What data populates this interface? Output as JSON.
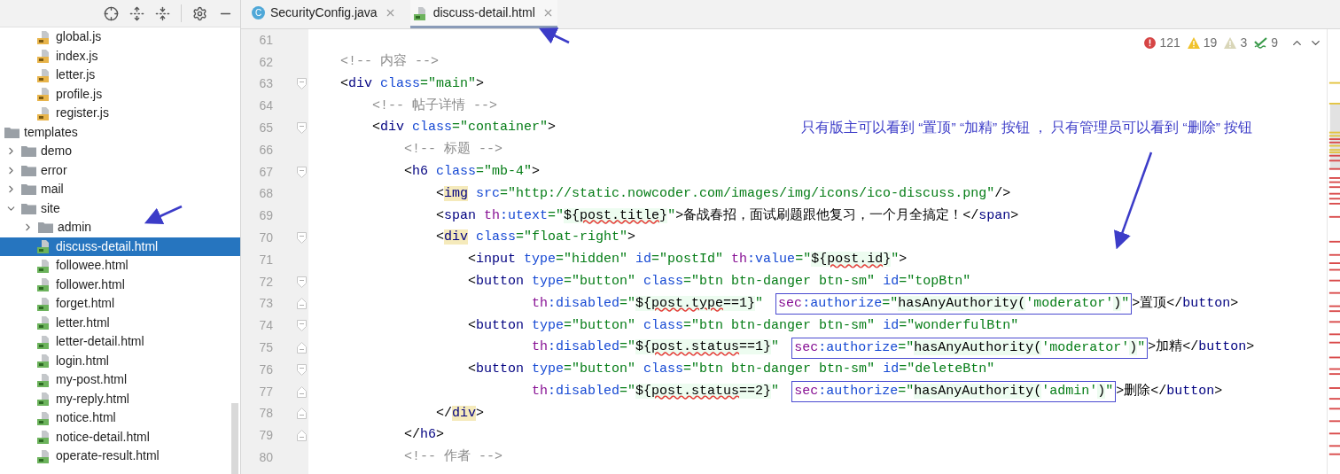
{
  "sidebar": {
    "scrolled_folder_children": [
      {
        "label": "global.js",
        "kind": "js",
        "selected": false
      },
      {
        "label": "index.js",
        "kind": "js",
        "selected": false
      },
      {
        "label": "letter.js",
        "kind": "js",
        "selected": false
      },
      {
        "label": "profile.js",
        "kind": "js",
        "selected": false
      },
      {
        "label": "register.js",
        "kind": "js",
        "selected": false
      }
    ],
    "tree": [
      {
        "label": "templates",
        "kind": "folder",
        "selected": false,
        "children": [
          {
            "label": "demo",
            "kind": "folder",
            "expanded": false,
            "selected": false
          },
          {
            "label": "error",
            "kind": "folder",
            "expanded": false,
            "selected": false
          },
          {
            "label": "mail",
            "kind": "folder",
            "expanded": false,
            "selected": false
          },
          {
            "label": "site",
            "kind": "folder",
            "expanded": true,
            "selected": false,
            "children": [
              {
                "label": "admin",
                "kind": "folder",
                "expanded": false,
                "selected": false
              },
              {
                "label": "discuss-detail.html",
                "kind": "html",
                "selected": true
              },
              {
                "label": "followee.html",
                "kind": "html",
                "selected": false
              },
              {
                "label": "follower.html",
                "kind": "html",
                "selected": false
              },
              {
                "label": "forget.html",
                "kind": "html",
                "selected": false
              },
              {
                "label": "letter.html",
                "kind": "html",
                "selected": false
              },
              {
                "label": "letter-detail.html",
                "kind": "html",
                "selected": false
              },
              {
                "label": "login.html",
                "kind": "html",
                "selected": false
              },
              {
                "label": "my-post.html",
                "kind": "html",
                "selected": false
              },
              {
                "label": "my-reply.html",
                "kind": "html",
                "selected": false
              },
              {
                "label": "notice.html",
                "kind": "html",
                "selected": false
              },
              {
                "label": "notice-detail.html",
                "kind": "html",
                "selected": false
              },
              {
                "label": "operate-result.html",
                "kind": "html",
                "selected": false
              }
            ]
          }
        ]
      }
    ]
  },
  "tabs": [
    {
      "label": "SecurityConfig.java",
      "kind": "java",
      "icon_letter": "C",
      "selected": false
    },
    {
      "label": "discuss-detail.html",
      "kind": "html",
      "selected": true
    }
  ],
  "inspections": [
    {
      "kind": "error",
      "count": "121"
    },
    {
      "kind": "warning",
      "count": "19"
    },
    {
      "kind": "weak_warning",
      "count": "3"
    },
    {
      "kind": "typo",
      "count": "9"
    }
  ],
  "annotation": "只有版主可以看到 “置顶” “加精” 按钮 ， 只有管理员可以看到 “删除” 按钮",
  "code_lines": [
    {
      "number": "61"
    },
    {
      "number": "62",
      "tokens": [
        {
          "kind": "comment",
          "text": "<!-- 内容 -->"
        }
      ]
    },
    {
      "number": "63",
      "fold_start": true,
      "tokens": [
        {
          "kind": "punct",
          "text": "<"
        },
        {
          "kind": "tag",
          "text": "div"
        },
        {
          "kind": "attr",
          "text": " class"
        },
        {
          "kind": "str",
          "text": "=\"main\""
        },
        {
          "kind": "punct",
          "text": ">"
        }
      ],
      "children": [
        {
          "number": "64",
          "tokens": [
            {
              "kind": "comment",
              "text": "<!-- 帖子详情 -->"
            }
          ]
        },
        {
          "number": "65",
          "fold_start": true,
          "tokens": [
            {
              "kind": "punct",
              "text": "<"
            },
            {
              "kind": "tag",
              "text": "div"
            },
            {
              "kind": "attr",
              "text": " class"
            },
            {
              "kind": "str",
              "text": "=\"container\""
            },
            {
              "kind": "punct",
              "text": ">"
            }
          ],
          "children": [
            {
              "number": "66",
              "tokens": [
                {
                  "kind": "comment",
                  "text": "<!-- 标题 -->"
                }
              ]
            },
            {
              "number": "67",
              "fold_start": true,
              "tokens": [
                {
                  "kind": "punct",
                  "text": "<"
                },
                {
                  "kind": "tag",
                  "text": "h6"
                },
                {
                  "kind": "attr",
                  "text": " class"
                },
                {
                  "kind": "str",
                  "text": "=\"mb-4\""
                },
                {
                  "kind": "punct",
                  "text": ">"
                }
              ],
              "children": [
                {
                  "number": "68",
                  "tokens": [
                    {
                      "kind": "punct",
                      "text": "<"
                    },
                    {
                      "kind": "tag_match",
                      "text": "img"
                    },
                    {
                      "kind": "attr",
                      "text": " src"
                    },
                    {
                      "kind": "str",
                      "text": "=\"http://static.nowcoder.com/images/img/icons/ico-discuss.png\""
                    },
                    {
                      "kind": "punct",
                      "text": "/>"
                    }
                  ]
                },
                {
                  "number": "69",
                  "tokens": [
                    {
                      "kind": "punct",
                      "text": "<"
                    },
                    {
                      "kind": "tag",
                      "text": "span"
                    },
                    {
                      "kind": "ns",
                      "text": " th"
                    },
                    {
                      "kind": "attr",
                      "text": ":utext"
                    },
                    {
                      "kind": "str",
                      "text": "=\""
                    },
                    {
                      "kind": "expr",
                      "text": "${"
                    },
                    {
                      "kind": "expr_typo",
                      "text": "post.title"
                    },
                    {
                      "kind": "expr",
                      "text": "}"
                    },
                    {
                      "kind": "str",
                      "text": "\""
                    },
                    {
                      "kind": "punct",
                      "text": ">备战春招，面试刷题跟他复习，一个月全搞定！</"
                    },
                    {
                      "kind": "tag",
                      "text": "span"
                    },
                    {
                      "kind": "punct",
                      "text": ">"
                    }
                  ]
                },
                {
                  "number": "70",
                  "fold_start": true,
                  "tokens": [
                    {
                      "kind": "punct",
                      "text": "<"
                    },
                    {
                      "kind": "tag_match",
                      "text": "div"
                    },
                    {
                      "kind": "attr",
                      "text": " class"
                    },
                    {
                      "kind": "str",
                      "text": "=\"float-right\""
                    },
                    {
                      "kind": "punct",
                      "text": ">"
                    }
                  ],
                  "children": [
                    {
                      "number": "71",
                      "tokens": [
                        {
                          "kind": "punct",
                          "text": "<"
                        },
                        {
                          "kind": "tag",
                          "text": "input"
                        },
                        {
                          "kind": "attr",
                          "text": " type"
                        },
                        {
                          "kind": "str",
                          "text": "=\"hidden\""
                        },
                        {
                          "kind": "attr",
                          "text": " id"
                        },
                        {
                          "kind": "str",
                          "text": "=\"postId\""
                        },
                        {
                          "kind": "ns",
                          "text": " th"
                        },
                        {
                          "kind": "attr",
                          "text": ":value"
                        },
                        {
                          "kind": "str",
                          "text": "=\""
                        },
                        {
                          "kind": "expr",
                          "text": "${"
                        },
                        {
                          "kind": "expr_typo",
                          "text": "post.id"
                        },
                        {
                          "kind": "expr",
                          "text": "}"
                        },
                        {
                          "kind": "str",
                          "text": "\""
                        },
                        {
                          "kind": "punct",
                          "text": ">"
                        }
                      ]
                    },
                    {
                      "number": "72",
                      "fold_start": true,
                      "tokens": [
                        {
                          "kind": "punct",
                          "text": "<"
                        },
                        {
                          "kind": "tag",
                          "text": "button"
                        },
                        {
                          "kind": "attr",
                          "text": " type"
                        },
                        {
                          "kind": "str",
                          "text": "=\"button\""
                        },
                        {
                          "kind": "attr",
                          "text": " class"
                        },
                        {
                          "kind": "str",
                          "text": "=\"btn btn-danger btn-sm\""
                        },
                        {
                          "kind": "attr",
                          "text": " id"
                        },
                        {
                          "kind": "str",
                          "text": "=\"topBtn\""
                        }
                      ],
                      "children": [
                        {
                          "number": "73",
                          "kind": "continuation",
                          "fold_end": true,
                          "tokens": [
                            {
                              "kind": "ns",
                              "text": "th"
                            },
                            {
                              "kind": "attr",
                              "text": ":disabled"
                            },
                            {
                              "kind": "str",
                              "text": "=\""
                            },
                            {
                              "kind": "expr",
                              "text": "${"
                            },
                            {
                              "kind": "expr_typo",
                              "text": "post.type"
                            },
                            {
                              "kind": "expr",
                              "text": "==1}"
                            },
                            {
                              "kind": "str",
                              "text": "\" "
                            },
                            {
                              "kind": "box",
                              "tokens": [
                                {
                                  "kind": "ns",
                                  "text": "sec"
                                },
                                {
                                  "kind": "attr",
                                  "text": ":authorize"
                                },
                                {
                                  "kind": "str",
                                  "text": "=\""
                                },
                                {
                                  "kind": "expr",
                                  "text": "hasAnyAuthority("
                                },
                                {
                                  "kind": "str",
                                  "text": "'moderator'"
                                },
                                {
                                  "kind": "expr",
                                  "text": ")"
                                },
                                {
                                  "kind": "str",
                                  "text": "\""
                                }
                              ]
                            },
                            {
                              "kind": "punct",
                              "text": ">置顶</"
                            },
                            {
                              "kind": "tag",
                              "text": "button"
                            },
                            {
                              "kind": "punct",
                              "text": ">"
                            }
                          ]
                        }
                      ]
                    },
                    {
                      "number": "74",
                      "fold_start": true,
                      "tokens": [
                        {
                          "kind": "punct",
                          "text": "<"
                        },
                        {
                          "kind": "tag",
                          "text": "button"
                        },
                        {
                          "kind": "attr",
                          "text": " type"
                        },
                        {
                          "kind": "str",
                          "text": "=\"button\""
                        },
                        {
                          "kind": "attr",
                          "text": " class"
                        },
                        {
                          "kind": "str",
                          "text": "=\"btn btn-danger btn-sm\""
                        },
                        {
                          "kind": "attr",
                          "text": " id"
                        },
                        {
                          "kind": "str",
                          "text": "=\"wonderfulBtn\""
                        }
                      ],
                      "children": [
                        {
                          "number": "75",
                          "kind": "continuation",
                          "fold_end": true,
                          "tokens": [
                            {
                              "kind": "ns",
                              "text": "th"
                            },
                            {
                              "kind": "attr",
                              "text": ":disabled"
                            },
                            {
                              "kind": "str",
                              "text": "=\""
                            },
                            {
                              "kind": "expr",
                              "text": "${"
                            },
                            {
                              "kind": "expr_typo",
                              "text": "post.status"
                            },
                            {
                              "kind": "expr",
                              "text": "==1}"
                            },
                            {
                              "kind": "str",
                              "text": "\" "
                            },
                            {
                              "kind": "box",
                              "tokens": [
                                {
                                  "kind": "ns",
                                  "text": "sec"
                                },
                                {
                                  "kind": "attr",
                                  "text": ":authorize"
                                },
                                {
                                  "kind": "str",
                                  "text": "=\""
                                },
                                {
                                  "kind": "expr",
                                  "text": "hasAnyAuthority("
                                },
                                {
                                  "kind": "str",
                                  "text": "'moderator'"
                                },
                                {
                                  "kind": "expr",
                                  "text": ")"
                                },
                                {
                                  "kind": "str",
                                  "text": "\""
                                }
                              ]
                            },
                            {
                              "kind": "punct",
                              "text": ">加精</"
                            },
                            {
                              "kind": "tag",
                              "text": "button"
                            },
                            {
                              "kind": "punct",
                              "text": ">"
                            }
                          ]
                        }
                      ]
                    },
                    {
                      "number": "76",
                      "fold_start": true,
                      "tokens": [
                        {
                          "kind": "punct",
                          "text": "<"
                        },
                        {
                          "kind": "tag",
                          "text": "button"
                        },
                        {
                          "kind": "attr",
                          "text": " type"
                        },
                        {
                          "kind": "str",
                          "text": "=\"button\""
                        },
                        {
                          "kind": "attr",
                          "text": " class"
                        },
                        {
                          "kind": "str",
                          "text": "=\"btn btn-danger btn-sm\""
                        },
                        {
                          "kind": "attr",
                          "text": " id"
                        },
                        {
                          "kind": "str",
                          "text": "=\"deleteBtn\""
                        }
                      ],
                      "children": [
                        {
                          "number": "77",
                          "kind": "continuation",
                          "fold_end": true,
                          "tokens": [
                            {
                              "kind": "ns",
                              "text": "th"
                            },
                            {
                              "kind": "attr",
                              "text": ":disabled"
                            },
                            {
                              "kind": "str",
                              "text": "=\""
                            },
                            {
                              "kind": "expr",
                              "text": "${"
                            },
                            {
                              "kind": "expr_typo",
                              "text": "post.status"
                            },
                            {
                              "kind": "expr",
                              "text": "==2}"
                            },
                            {
                              "kind": "str",
                              "text": "\" "
                            },
                            {
                              "kind": "box",
                              "tokens": [
                                {
                                  "kind": "ns",
                                  "text": "sec"
                                },
                                {
                                  "kind": "attr",
                                  "text": ":authorize"
                                },
                                {
                                  "kind": "str",
                                  "text": "=\""
                                },
                                {
                                  "kind": "expr",
                                  "text": "hasAnyAuthority("
                                },
                                {
                                  "kind": "str",
                                  "text": "'admin'"
                                },
                                {
                                  "kind": "expr",
                                  "text": ")"
                                },
                                {
                                  "kind": "str",
                                  "text": "\""
                                }
                              ]
                            },
                            {
                              "kind": "punct",
                              "text": ">删除</"
                            },
                            {
                              "kind": "tag",
                              "text": "button"
                            },
                            {
                              "kind": "punct",
                              "text": ">"
                            }
                          ]
                        }
                      ]
                    }
                  ]
                },
                {
                  "number": "78",
                  "fold_end": true,
                  "tokens": [
                    {
                      "kind": "punct",
                      "text": "</"
                    },
                    {
                      "kind": "tag_match",
                      "text": "div"
                    },
                    {
                      "kind": "punct",
                      "text": ">"
                    }
                  ]
                }
              ]
            },
            {
              "number": "79",
              "fold_end": true,
              "tokens": [
                {
                  "kind": "punct",
                  "text": "</"
                },
                {
                  "kind": "tag",
                  "text": "h6"
                },
                {
                  "kind": "punct",
                  "text": ">"
                }
              ]
            },
            {
              "number": "80",
              "tokens": [
                {
                  "kind": "comment",
                  "text": "<!-- 作者 -->"
                }
              ]
            }
          ]
        }
      ]
    }
  ]
}
